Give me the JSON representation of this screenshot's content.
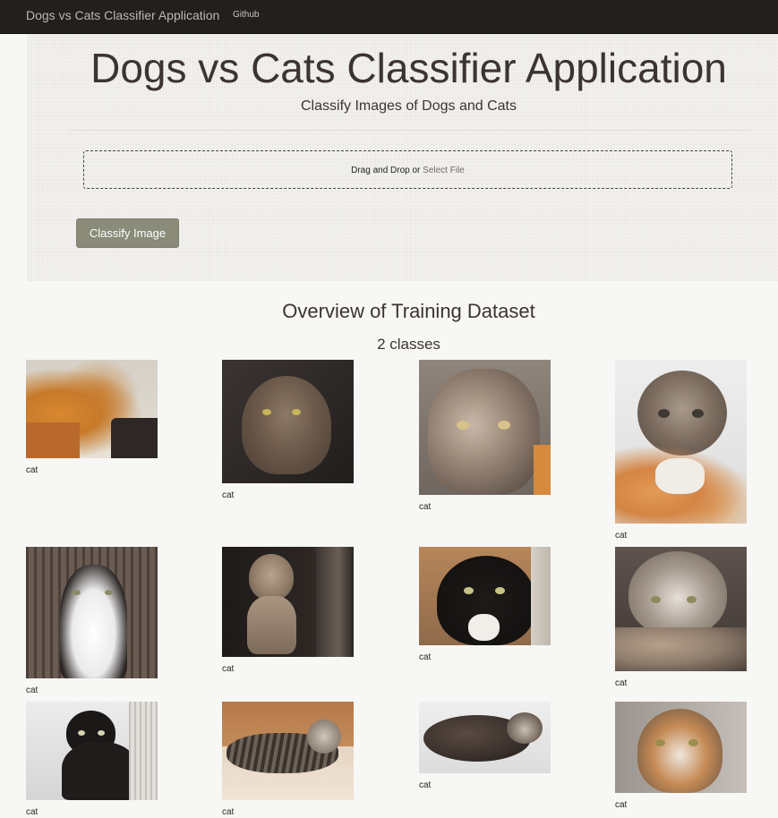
{
  "navbar": {
    "brand": "Dogs vs Cats Classifier Application",
    "links": [
      "Github"
    ]
  },
  "hero": {
    "title": "Dogs vs Cats Classifier Application",
    "subtitle": "Classify Images of Dogs and Cats",
    "dropzone_text": "Drag and Drop or ",
    "dropzone_link": "Select File",
    "classify_button": "Classify Image"
  },
  "overview": {
    "title": "Overview of Training Dataset",
    "classes": "2 classes"
  },
  "gallery": [
    {
      "label": "cat"
    },
    {
      "label": "cat"
    },
    {
      "label": "cat"
    },
    {
      "label": "cat"
    },
    {
      "label": "cat"
    },
    {
      "label": "cat"
    },
    {
      "label": "cat"
    },
    {
      "label": "cat"
    },
    {
      "label": "cat"
    },
    {
      "label": "cat"
    },
    {
      "label": "cat"
    },
    {
      "label": "cat"
    }
  ],
  "colors": {
    "navbar_bg": "#221f1d",
    "button_bg": "#8a8b78",
    "page_bg": "#f7f7f5"
  }
}
